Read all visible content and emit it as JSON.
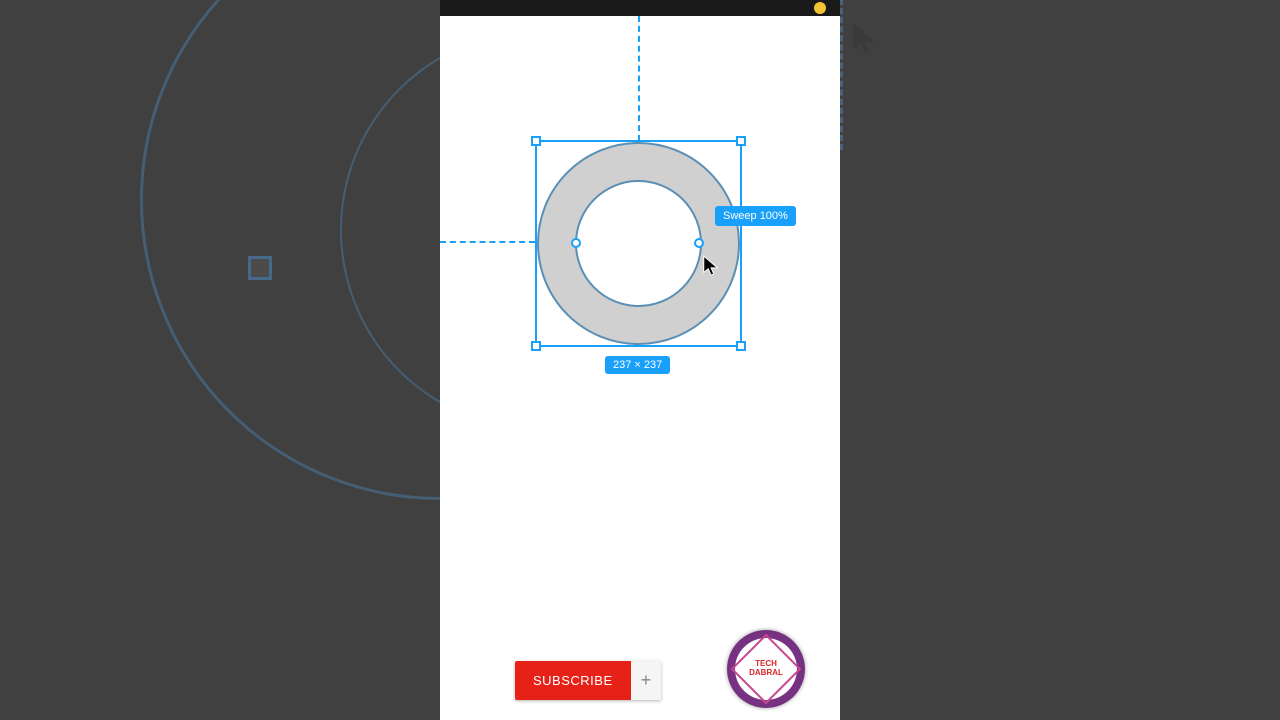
{
  "selection": {
    "dimensions": "237 × 237",
    "tooltip": "Sweep 100%"
  },
  "subscribe": {
    "label": "SUBSCRIBE",
    "plus": "+"
  },
  "channel": {
    "line1": "TECH",
    "line2": "DABRAL"
  },
  "colors": {
    "accent": "#18a0fb",
    "subscribe": "#e62117"
  }
}
